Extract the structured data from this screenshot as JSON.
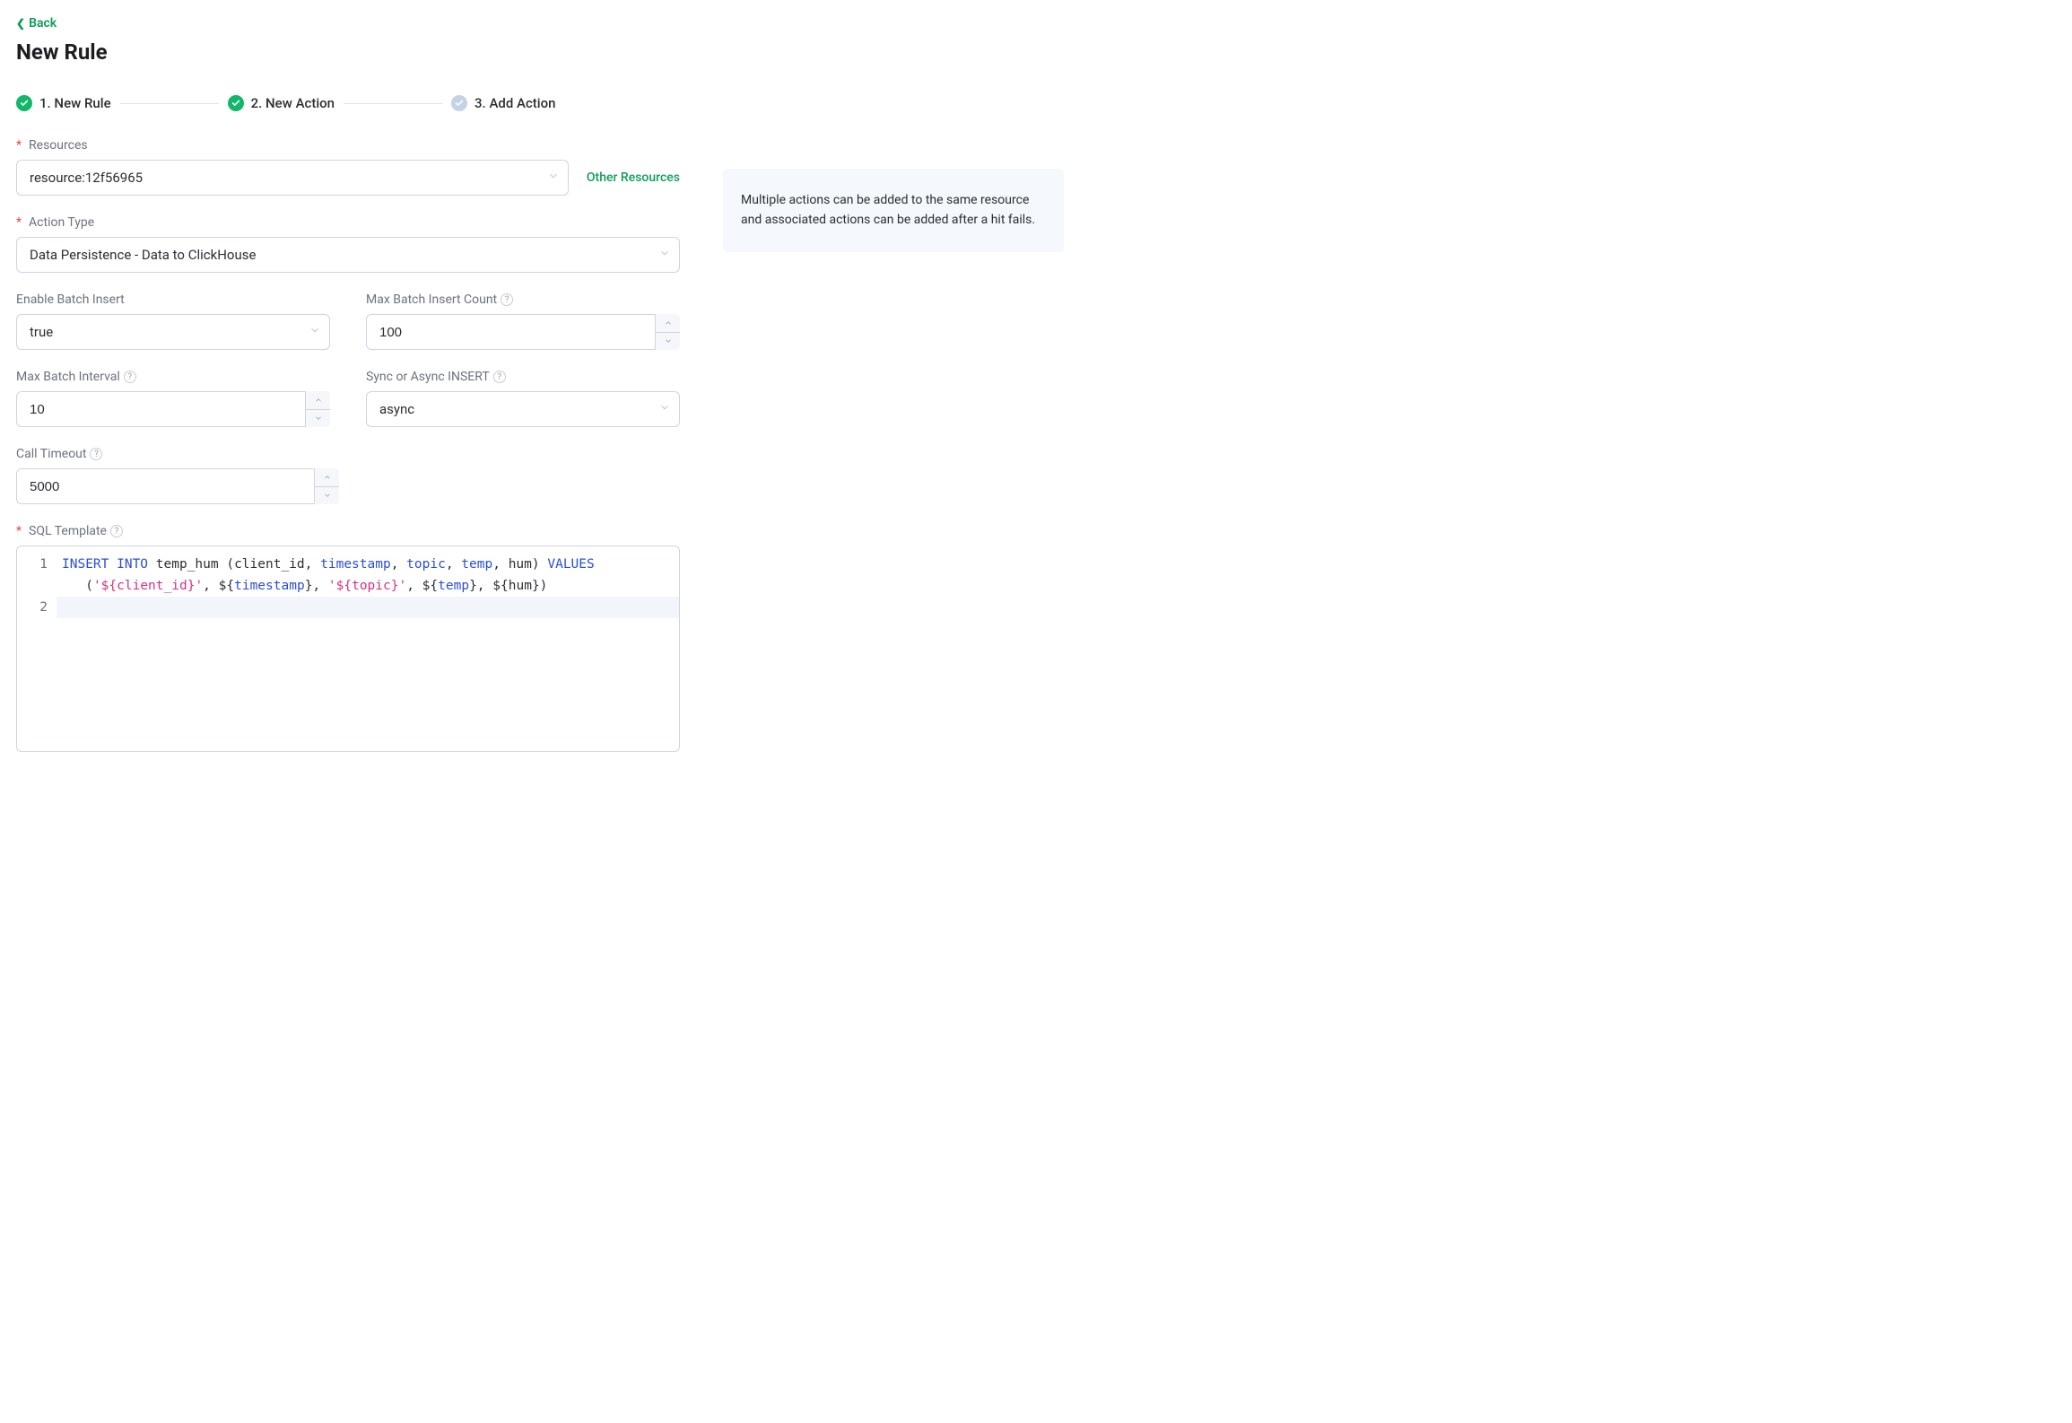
{
  "nav": {
    "back_label": "Back"
  },
  "page": {
    "title": "New Rule"
  },
  "steps": {
    "s1": "1. New Rule",
    "s2": "2. New Action",
    "s3": "3. Add Action"
  },
  "fields": {
    "resources_label": "Resources",
    "resources_value": "resource:12f56965",
    "other_resources_link": "Other Resources",
    "action_type_label": "Action Type",
    "action_type_value": "Data Persistence - Data to ClickHouse",
    "enable_batch_label": "Enable Batch Insert",
    "enable_batch_value": "true",
    "max_batch_count_label": "Max Batch Insert Count",
    "max_batch_count_value": "100",
    "max_batch_interval_label": "Max Batch Interval",
    "max_batch_interval_value": "10",
    "sync_async_label": "Sync or Async INSERT",
    "sync_async_value": "async",
    "call_timeout_label": "Call Timeout",
    "call_timeout_value": "5000",
    "sql_template_label": "SQL Template"
  },
  "sql": {
    "raw": "INSERT INTO temp_hum (client_id, timestamp, topic, temp, hum) VALUES ('${client_id}', ${timestamp}, '${topic}', ${temp}, ${hum})",
    "line1_tokens": {
      "kw1": "INSERT INTO",
      "tbl": " temp_hum ",
      "lp": "(",
      "c1": "client_id",
      "comma1": ", ",
      "c2": "timestamp",
      "comma2": ", ",
      "c3": "topic",
      "comma3": ", ",
      "c4": "temp",
      "comma4": ", ",
      "c5": "hum",
      "rp": ") ",
      "kw2": "VALUES"
    },
    "line1b_tokens": {
      "indent": "   ",
      "lp": "(",
      "q1a": "'",
      "v1a": "${client_id}",
      "q1b": "'",
      "c1": ", ",
      "d2": "$",
      "b2a": "{",
      "v2": "timestamp",
      "b2b": "}",
      "c2": ", ",
      "q3a": "'",
      "v3a": "${topic}",
      "q3b": "'",
      "c3": ", ",
      "d4": "$",
      "b4a": "{",
      "v4": "temp",
      "b4b": "}",
      "c4": ", ",
      "d5": "$",
      "b5a": "{",
      "v5": "hum",
      "b5b": "}",
      "rp": ")"
    },
    "lines": [
      "1",
      "2"
    ]
  },
  "info": {
    "text": "Multiple actions can be added to the same resource and associated actions can be added after a hit fails."
  }
}
